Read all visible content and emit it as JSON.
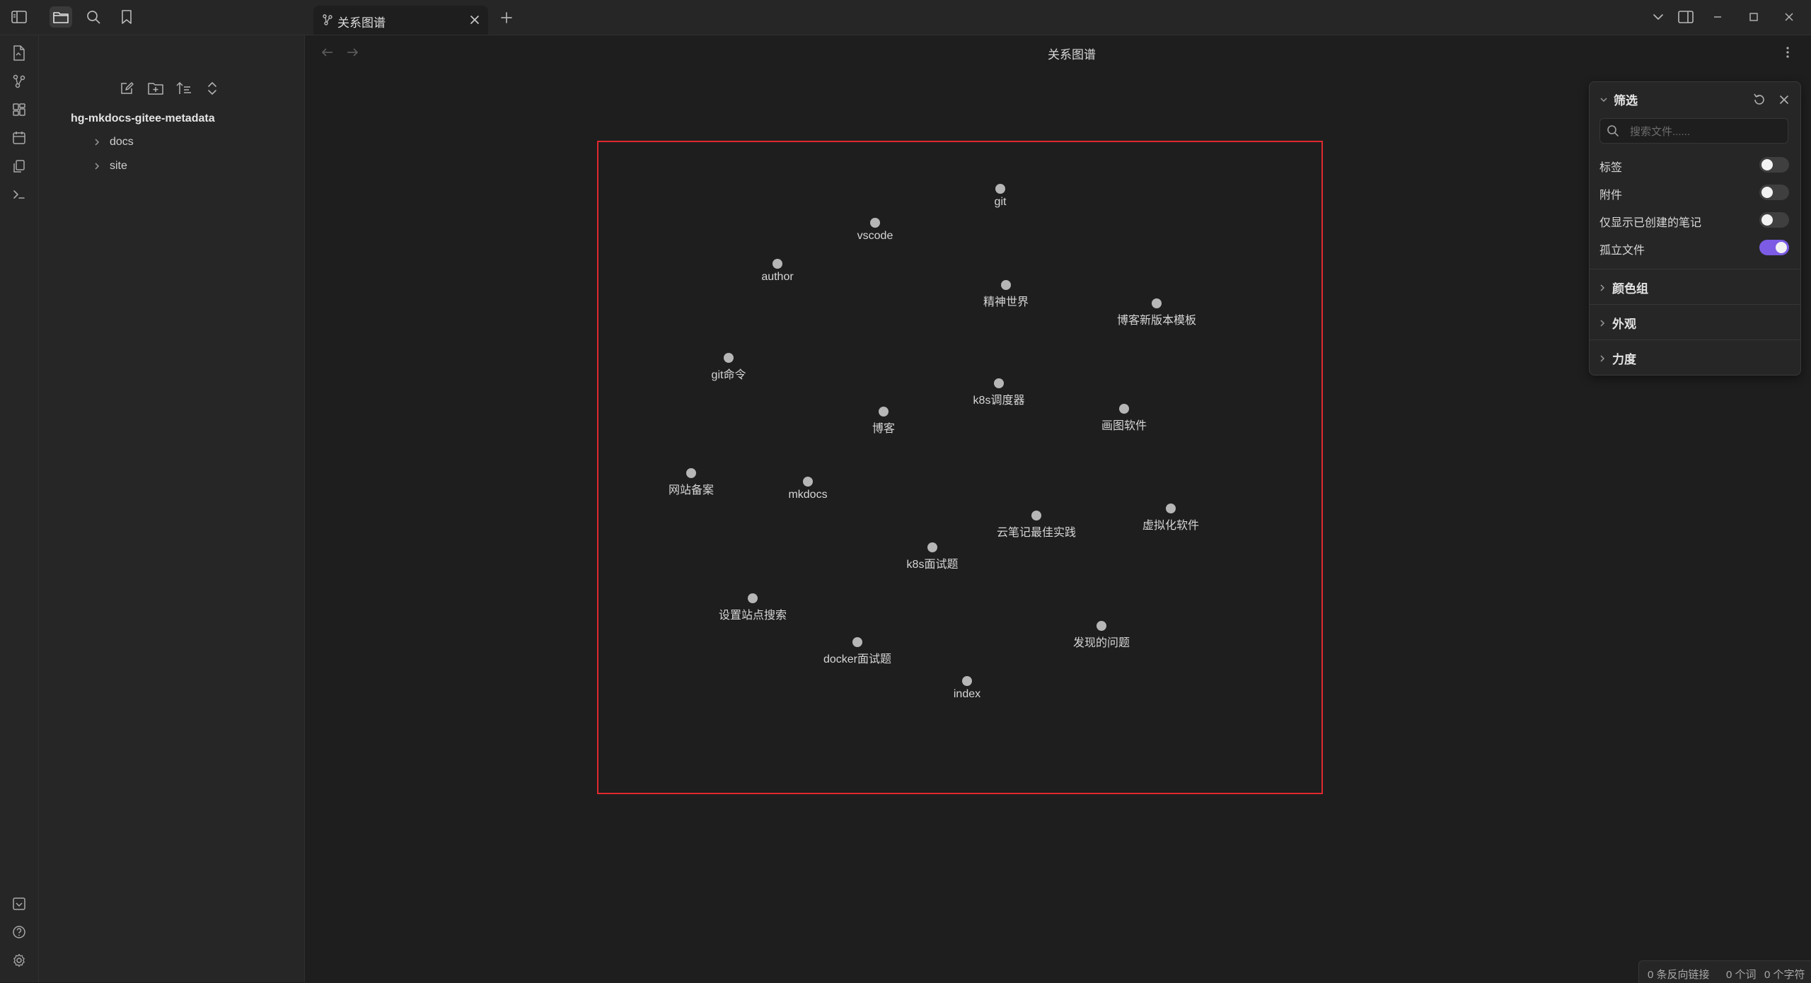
{
  "tab": {
    "title": "关系图谱"
  },
  "sidebar": {
    "vault_name": "hg-mkdocs-gitee-metadata",
    "folders": [
      {
        "label": "docs"
      },
      {
        "label": "site"
      }
    ]
  },
  "view": {
    "title": "关系图谱"
  },
  "graph": {
    "nodes": [
      {
        "label": "git"
      },
      {
        "label": "vscode"
      },
      {
        "label": "author"
      },
      {
        "label": "精神世界"
      },
      {
        "label": "博客新版本模板"
      },
      {
        "label": "git命令"
      },
      {
        "label": "k8s调度器"
      },
      {
        "label": "博客"
      },
      {
        "label": "画图软件"
      },
      {
        "label": "网站备案"
      },
      {
        "label": "mkdocs"
      },
      {
        "label": "云笔记最佳实践"
      },
      {
        "label": "虚拟化软件"
      },
      {
        "label": "k8s面试题"
      },
      {
        "label": "设置站点搜索"
      },
      {
        "label": "发现的问题"
      },
      {
        "label": "docker面试题"
      },
      {
        "label": "index"
      }
    ]
  },
  "filter_panel": {
    "title": "筛选",
    "search_placeholder": "搜索文件......",
    "toggles": [
      {
        "label": "标签",
        "on": false
      },
      {
        "label": "附件",
        "on": false
      },
      {
        "label": "仅显示已创建的笔记",
        "on": false
      },
      {
        "label": "孤立文件",
        "on": true
      }
    ],
    "sections": [
      {
        "label": "颜色组"
      },
      {
        "label": "外观"
      },
      {
        "label": "力度"
      }
    ],
    "accent_color": "#7c5ce4"
  },
  "status_bar": {
    "backlinks": "0 条反向链接",
    "words": "0 个词",
    "chars": "0 个字符"
  },
  "icons": {
    "top": [
      "sidebar-toggle-icon",
      "folder-icon",
      "search-icon",
      "bookmark-icon"
    ],
    "ribbon": [
      "file-switcher-icon",
      "graph-view-icon",
      "canvas-icon",
      "daily-note-icon",
      "templates-icon",
      "command-palette-icon",
      "vault-switcher-icon",
      "help-icon",
      "settings-icon"
    ]
  }
}
